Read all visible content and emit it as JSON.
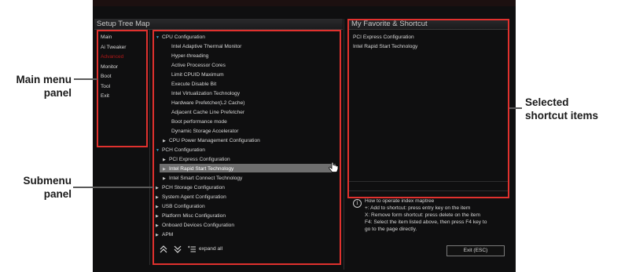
{
  "annotations": {
    "main_menu_panel": "Main menu\npanel",
    "submenu_panel": "Submenu\npanel",
    "selected_shortcut_items": "Selected\nshortcut items"
  },
  "setup_tree": {
    "title": "Setup Tree Map",
    "main_menu": [
      {
        "label": "Main",
        "active": false
      },
      {
        "label": "Ai Tweaker",
        "active": false
      },
      {
        "label": "Advanced",
        "active": true
      },
      {
        "label": "Monitor",
        "active": false
      },
      {
        "label": "Boot",
        "active": false
      },
      {
        "label": "Tool",
        "active": false
      },
      {
        "label": "Exit",
        "active": false
      }
    ],
    "submenu": [
      {
        "label": "CPU Configuration",
        "level": 0,
        "arrow": "open"
      },
      {
        "label": "Intel Adaptive Thermal Monitor",
        "level": 2,
        "arrow": "none"
      },
      {
        "label": "Hyper-threading",
        "level": 2,
        "arrow": "none"
      },
      {
        "label": "Active Processor Cores",
        "level": 2,
        "arrow": "none"
      },
      {
        "label": "Limit CPUID Maximum",
        "level": 2,
        "arrow": "none"
      },
      {
        "label": "Execute Disable Bit",
        "level": 2,
        "arrow": "none"
      },
      {
        "label": "Intel Virtualization Technology",
        "level": 2,
        "arrow": "none"
      },
      {
        "label": "Hardware Prefetcher(L2 Cache)",
        "level": 2,
        "arrow": "none"
      },
      {
        "label": "Adjacent Cache Line Prefetcher",
        "level": 2,
        "arrow": "none"
      },
      {
        "label": "Boot performance mode",
        "level": 2,
        "arrow": "none"
      },
      {
        "label": "Dynamic Storage Accelerator",
        "level": 2,
        "arrow": "none"
      },
      {
        "label": "CPU Power Management Configuration",
        "level": 1,
        "arrow": "closed"
      },
      {
        "label": "PCH Configuration",
        "level": 0,
        "arrow": "open"
      },
      {
        "label": "PCI Express Configuration",
        "level": 1,
        "arrow": "closed"
      },
      {
        "label": "Intel Rapid Start Technology",
        "level": 1,
        "arrow": "closed",
        "selected": true
      },
      {
        "label": "Intel Smart Connect Technology",
        "level": 1,
        "arrow": "closed"
      },
      {
        "label": "PCH Storage Configuration",
        "level": 0,
        "arrow": "closed"
      },
      {
        "label": "System Agent Configuration",
        "level": 0,
        "arrow": "closed"
      },
      {
        "label": "USB Configuration",
        "level": 0,
        "arrow": "closed"
      },
      {
        "label": "Platform Misc Configuration",
        "level": 0,
        "arrow": "closed"
      },
      {
        "label": "Onboard Devices Configuration",
        "level": 0,
        "arrow": "closed"
      },
      {
        "label": "APM",
        "level": 0,
        "arrow": "closed"
      }
    ],
    "toolbar": {
      "collapse_icon": "double-chevron-up-icon",
      "expand_icon": "double-chevron-down-icon",
      "expand_all_label": "expand all"
    }
  },
  "favorites": {
    "title": "My Favorite & Shortcut",
    "items": [
      "PCI Express Configuration",
      "Intel Rapid Start Technology"
    ]
  },
  "help": {
    "lines": [
      "How to operate index maptree",
      "+: Add to shortcut: press entry key on the item",
      "X: Remove form shortcut: press delete on the item",
      "F4: Select the item listed above, then press F4 key to",
      "go to the page directly."
    ]
  },
  "exit_button_label": "Exit (ESC)",
  "colors": {
    "annotation_box": "#e0312e",
    "active_menu": "#b01818",
    "open_arrow": "#3aa0c8",
    "selected_row": "#6e6e6e"
  }
}
